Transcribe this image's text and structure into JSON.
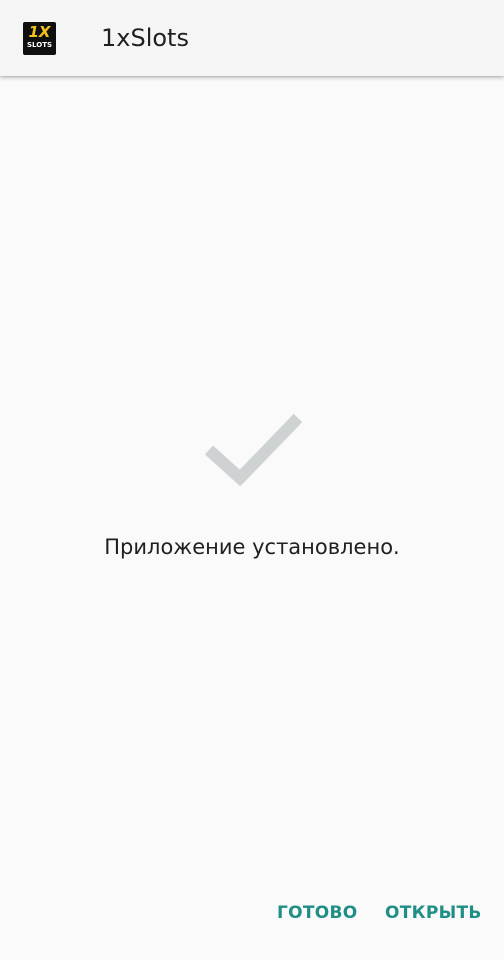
{
  "app_bar": {
    "icon_text_top": "1X",
    "icon_text_bottom": "SLOTS",
    "title": "1xSlots"
  },
  "content": {
    "status_icon": "checkmark-icon",
    "message": "Приложение установлено."
  },
  "actions": {
    "done_label": "ГОТОВО",
    "open_label": "ОТКРЫТЬ"
  },
  "colors": {
    "accent": "#1f8f86",
    "check": "#cfd2d3",
    "background": "#fafafa",
    "app_bar": "#f5f5f5"
  }
}
